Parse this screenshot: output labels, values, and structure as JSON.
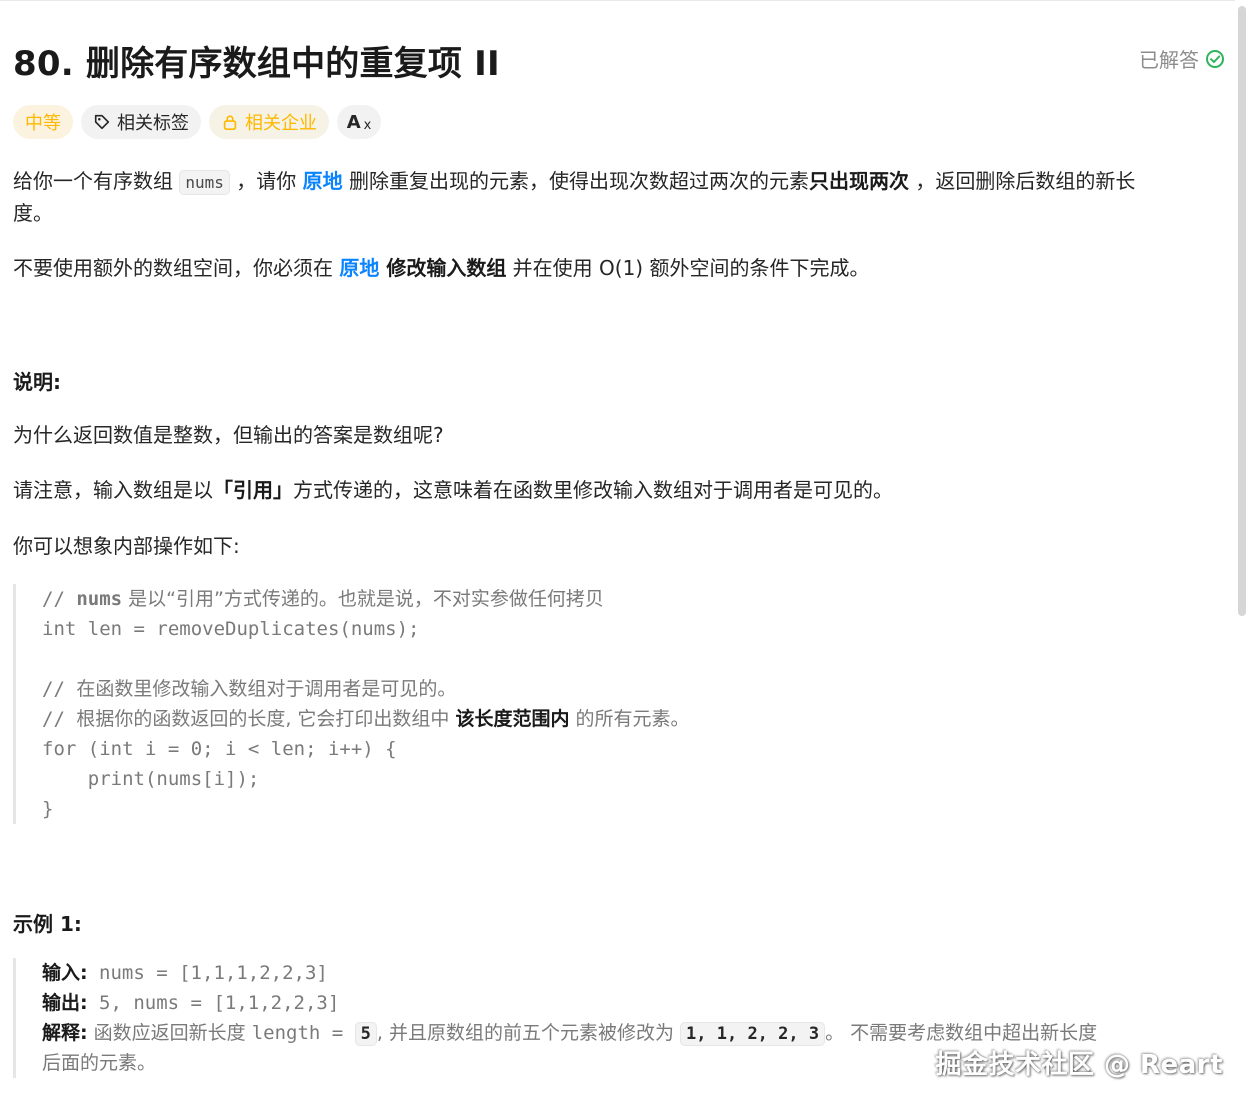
{
  "problem": {
    "title": "80. 删除有序数组中的重复项 II",
    "status": "已解答"
  },
  "tags": {
    "difficulty": "中等",
    "related_tags": "相关标签",
    "related_companies": "相关企业",
    "translate": "A"
  },
  "description": {
    "p1": {
      "t1": "给你一个有序数组 ",
      "code": "nums",
      "t2": " ，请你 ",
      "em1": "原地",
      "t3": " 删除重复出现的元素，使得出现次数超过两次的元素",
      "strong": "只出现两次",
      "t4": " ，返回删除后数组的新长",
      "t5": "度。"
    },
    "p2": {
      "t1": "不要使用额外的数组空间，你必须在 ",
      "em": "原地",
      "strong": " 修改输入数组",
      "t2": " 并在使用 O(1) 额外空间的条件下完成。"
    }
  },
  "explanation": {
    "heading": "说明:",
    "q": "为什么返回数值是整数，但输出的答案是数组呢?",
    "p1_t1": "请注意，输入数组是以",
    "p1_strong": "「引用」",
    "p1_t2": "方式传递的，这意味着在函数里修改输入数组对于调用者是可见的。",
    "p2": "你可以想象内部操作如下:"
  },
  "code": {
    "l1_prefix": "// ",
    "l1_bold": "nums",
    "l1_text": " 是以“引用”方式传递的。也就是说，不对实参做任何拷贝",
    "l2": "int len = removeDuplicates(nums);",
    "l4_prefix": "// ",
    "l4_text": "在函数里修改输入数组对于调用者是可见的。",
    "l5_prefix": "// ",
    "l5_text1": "根据你的函数返回的长度, 它会打印出数组中 ",
    "l5_bold": "该长度范围内",
    "l5_text2": " 的所有元素。",
    "l6": "for (int i = 0; i < len; i++) {",
    "l7": "    print(nums[i]);",
    "l8": "}"
  },
  "example1": {
    "heading": "示例 1:",
    "input_label": "输入:",
    "input_value": " nums = [1,1,1,2,2,3]",
    "output_label": "输出:",
    "output_value": " 5, nums = [1,1,2,2,3]",
    "explain_label": "解释:",
    "explain_t1": " 函数应返回新长度 ",
    "explain_code1": "length = ",
    "explain_code2": "5",
    "explain_t2": ", 并且原数组的前五个元素被修改为 ",
    "explain_code3": "1, 1, 2, 2, 3",
    "explain_t3": "。 不需要考虑数组中超出新长度",
    "explain_t4": "后面的元素。"
  },
  "watermark": "掘金技术社区 @ Reart",
  "colors": {
    "accent_blue": "#0a84ff",
    "difficulty_yellow": "#ffb800",
    "solved_green": "#2db55d"
  }
}
